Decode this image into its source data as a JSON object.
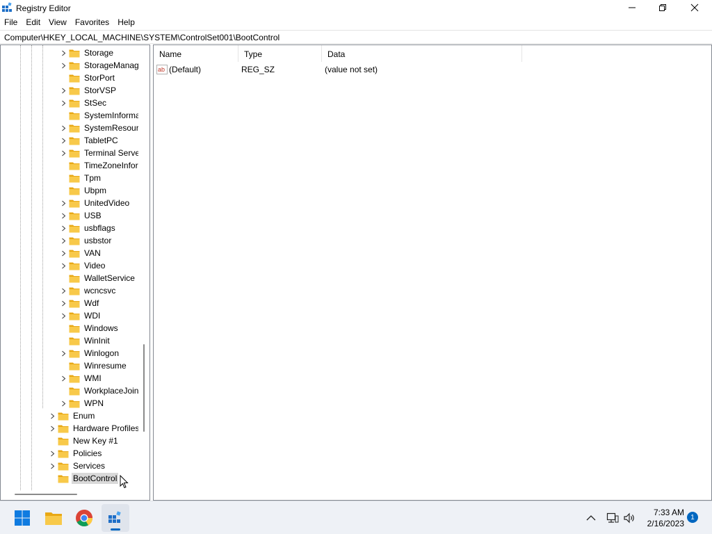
{
  "window": {
    "title": "Registry Editor"
  },
  "menu": [
    {
      "label": "File"
    },
    {
      "label": "Edit"
    },
    {
      "label": "View"
    },
    {
      "label": "Favorites"
    },
    {
      "label": "Help"
    }
  ],
  "address": "Computer\\HKEY_LOCAL_MACHINE\\SYSTEM\\ControlSet001\\BootControl",
  "tree": {
    "children": [
      {
        "label": "Storage",
        "expandable": true
      },
      {
        "label": "StorageManag",
        "expandable": true
      },
      {
        "label": "StorPort",
        "expandable": false
      },
      {
        "label": "StorVSP",
        "expandable": true
      },
      {
        "label": "StSec",
        "expandable": true
      },
      {
        "label": "SystemInforma",
        "expandable": false
      },
      {
        "label": "SystemResour",
        "expandable": true
      },
      {
        "label": "TabletPC",
        "expandable": true
      },
      {
        "label": "Terminal Serve",
        "expandable": true
      },
      {
        "label": "TimeZoneInfor",
        "expandable": false
      },
      {
        "label": "Tpm",
        "expandable": false
      },
      {
        "label": "Ubpm",
        "expandable": false
      },
      {
        "label": "UnitedVideo",
        "expandable": true
      },
      {
        "label": "USB",
        "expandable": true
      },
      {
        "label": "usbflags",
        "expandable": true
      },
      {
        "label": "usbstor",
        "expandable": true
      },
      {
        "label": "VAN",
        "expandable": true
      },
      {
        "label": "Video",
        "expandable": true
      },
      {
        "label": "WalletService",
        "expandable": false
      },
      {
        "label": "wcncsvc",
        "expandable": true
      },
      {
        "label": "Wdf",
        "expandable": true
      },
      {
        "label": "WDI",
        "expandable": true
      },
      {
        "label": "Windows",
        "expandable": false
      },
      {
        "label": "WinInit",
        "expandable": false
      },
      {
        "label": "Winlogon",
        "expandable": true
      },
      {
        "label": "Winresume",
        "expandable": false
      },
      {
        "label": "WMI",
        "expandable": true
      },
      {
        "label": "WorkplaceJoin",
        "expandable": false
      },
      {
        "label": "WPN",
        "expandable": true
      }
    ],
    "siblings": [
      {
        "label": "Enum",
        "expandable": true
      },
      {
        "label": "Hardware Profiles",
        "expandable": true
      },
      {
        "label": "New Key #1",
        "expandable": false
      },
      {
        "label": "Policies",
        "expandable": true
      },
      {
        "label": "Services",
        "expandable": true
      },
      {
        "label": "BootControl",
        "expandable": false,
        "selected": true
      }
    ]
  },
  "values": {
    "columns": [
      {
        "label": "Name"
      },
      {
        "label": "Type"
      },
      {
        "label": "Data"
      }
    ],
    "rows": [
      {
        "name": "(Default)",
        "type": "REG_SZ",
        "data": "(value not set)",
        "icon": "string-value-icon"
      }
    ]
  },
  "taskbar": {
    "apps": [
      {
        "name": "start-button",
        "icon": "windows-logo-icon"
      },
      {
        "name": "file-explorer-button",
        "icon": "folder-icon"
      },
      {
        "name": "chrome-button",
        "icon": "chrome-icon"
      },
      {
        "name": "registry-editor-button",
        "icon": "regedit-icon",
        "active": true
      }
    ],
    "clock": {
      "time": "7:33 AM",
      "date": "2/16/2023"
    },
    "notification_count": "1"
  },
  "colors": {
    "accent": "#0067c0",
    "folder": "#f8c94a",
    "selected": "#d9d9d9"
  }
}
